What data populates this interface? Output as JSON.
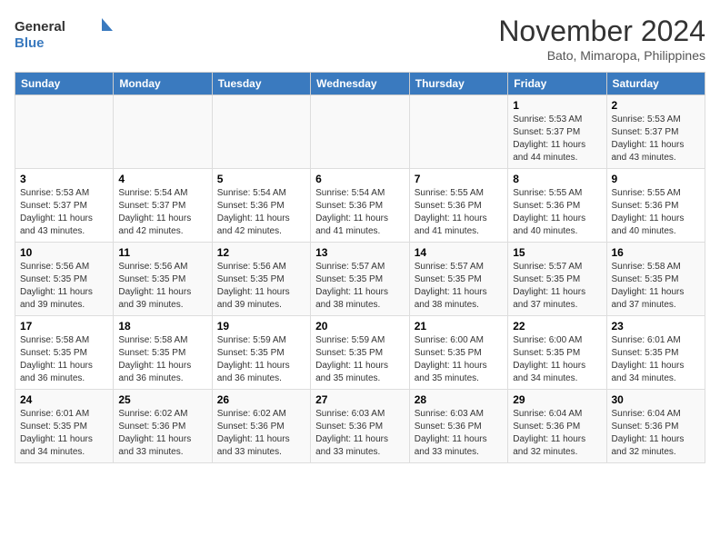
{
  "logo": {
    "text_general": "General",
    "text_blue": "Blue"
  },
  "header": {
    "month_year": "November 2024",
    "location": "Bato, Mimaropa, Philippines"
  },
  "weekdays": [
    "Sunday",
    "Monday",
    "Tuesday",
    "Wednesday",
    "Thursday",
    "Friday",
    "Saturday"
  ],
  "weeks": [
    [
      {
        "day": "",
        "info": ""
      },
      {
        "day": "",
        "info": ""
      },
      {
        "day": "",
        "info": ""
      },
      {
        "day": "",
        "info": ""
      },
      {
        "day": "",
        "info": ""
      },
      {
        "day": "1",
        "info": "Sunrise: 5:53 AM\nSunset: 5:37 PM\nDaylight: 11 hours\nand 44 minutes."
      },
      {
        "day": "2",
        "info": "Sunrise: 5:53 AM\nSunset: 5:37 PM\nDaylight: 11 hours\nand 43 minutes."
      }
    ],
    [
      {
        "day": "3",
        "info": "Sunrise: 5:53 AM\nSunset: 5:37 PM\nDaylight: 11 hours\nand 43 minutes."
      },
      {
        "day": "4",
        "info": "Sunrise: 5:54 AM\nSunset: 5:37 PM\nDaylight: 11 hours\nand 42 minutes."
      },
      {
        "day": "5",
        "info": "Sunrise: 5:54 AM\nSunset: 5:36 PM\nDaylight: 11 hours\nand 42 minutes."
      },
      {
        "day": "6",
        "info": "Sunrise: 5:54 AM\nSunset: 5:36 PM\nDaylight: 11 hours\nand 41 minutes."
      },
      {
        "day": "7",
        "info": "Sunrise: 5:55 AM\nSunset: 5:36 PM\nDaylight: 11 hours\nand 41 minutes."
      },
      {
        "day": "8",
        "info": "Sunrise: 5:55 AM\nSunset: 5:36 PM\nDaylight: 11 hours\nand 40 minutes."
      },
      {
        "day": "9",
        "info": "Sunrise: 5:55 AM\nSunset: 5:36 PM\nDaylight: 11 hours\nand 40 minutes."
      }
    ],
    [
      {
        "day": "10",
        "info": "Sunrise: 5:56 AM\nSunset: 5:35 PM\nDaylight: 11 hours\nand 39 minutes."
      },
      {
        "day": "11",
        "info": "Sunrise: 5:56 AM\nSunset: 5:35 PM\nDaylight: 11 hours\nand 39 minutes."
      },
      {
        "day": "12",
        "info": "Sunrise: 5:56 AM\nSunset: 5:35 PM\nDaylight: 11 hours\nand 39 minutes."
      },
      {
        "day": "13",
        "info": "Sunrise: 5:57 AM\nSunset: 5:35 PM\nDaylight: 11 hours\nand 38 minutes."
      },
      {
        "day": "14",
        "info": "Sunrise: 5:57 AM\nSunset: 5:35 PM\nDaylight: 11 hours\nand 38 minutes."
      },
      {
        "day": "15",
        "info": "Sunrise: 5:57 AM\nSunset: 5:35 PM\nDaylight: 11 hours\nand 37 minutes."
      },
      {
        "day": "16",
        "info": "Sunrise: 5:58 AM\nSunset: 5:35 PM\nDaylight: 11 hours\nand 37 minutes."
      }
    ],
    [
      {
        "day": "17",
        "info": "Sunrise: 5:58 AM\nSunset: 5:35 PM\nDaylight: 11 hours\nand 36 minutes."
      },
      {
        "day": "18",
        "info": "Sunrise: 5:58 AM\nSunset: 5:35 PM\nDaylight: 11 hours\nand 36 minutes."
      },
      {
        "day": "19",
        "info": "Sunrise: 5:59 AM\nSunset: 5:35 PM\nDaylight: 11 hours\nand 36 minutes."
      },
      {
        "day": "20",
        "info": "Sunrise: 5:59 AM\nSunset: 5:35 PM\nDaylight: 11 hours\nand 35 minutes."
      },
      {
        "day": "21",
        "info": "Sunrise: 6:00 AM\nSunset: 5:35 PM\nDaylight: 11 hours\nand 35 minutes."
      },
      {
        "day": "22",
        "info": "Sunrise: 6:00 AM\nSunset: 5:35 PM\nDaylight: 11 hours\nand 34 minutes."
      },
      {
        "day": "23",
        "info": "Sunrise: 6:01 AM\nSunset: 5:35 PM\nDaylight: 11 hours\nand 34 minutes."
      }
    ],
    [
      {
        "day": "24",
        "info": "Sunrise: 6:01 AM\nSunset: 5:35 PM\nDaylight: 11 hours\nand 34 minutes."
      },
      {
        "day": "25",
        "info": "Sunrise: 6:02 AM\nSunset: 5:36 PM\nDaylight: 11 hours\nand 33 minutes."
      },
      {
        "day": "26",
        "info": "Sunrise: 6:02 AM\nSunset: 5:36 PM\nDaylight: 11 hours\nand 33 minutes."
      },
      {
        "day": "27",
        "info": "Sunrise: 6:03 AM\nSunset: 5:36 PM\nDaylight: 11 hours\nand 33 minutes."
      },
      {
        "day": "28",
        "info": "Sunrise: 6:03 AM\nSunset: 5:36 PM\nDaylight: 11 hours\nand 33 minutes."
      },
      {
        "day": "29",
        "info": "Sunrise: 6:04 AM\nSunset: 5:36 PM\nDaylight: 11 hours\nand 32 minutes."
      },
      {
        "day": "30",
        "info": "Sunrise: 6:04 AM\nSunset: 5:36 PM\nDaylight: 11 hours\nand 32 minutes."
      }
    ]
  ]
}
